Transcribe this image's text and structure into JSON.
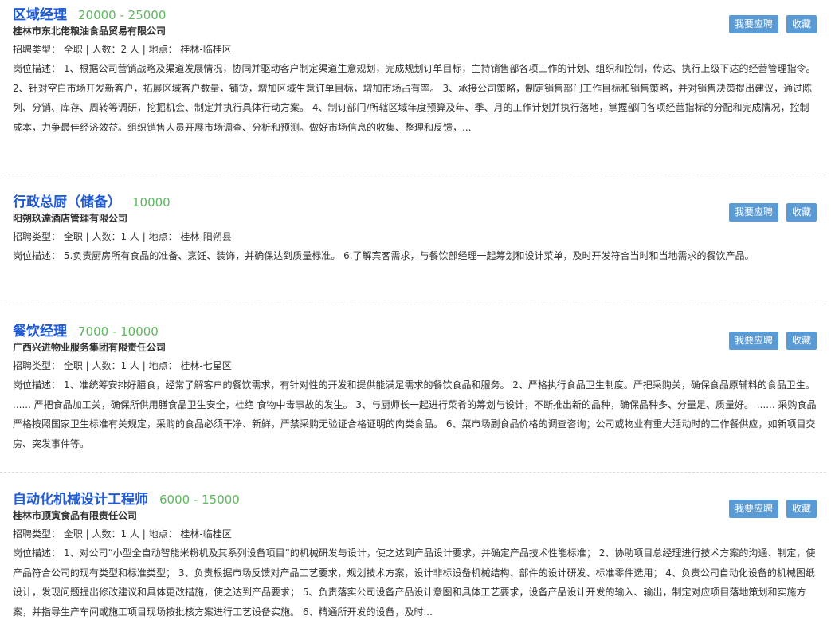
{
  "labels": {
    "type_prefix": "招聘类型：",
    "count_prefix": "人数：",
    "location_prefix": "地点：",
    "desc_prefix": "岗位描述：",
    "apply_button": "我要应聘",
    "favorite_button": "收藏"
  },
  "jobs": [
    {
      "title": "区域经理",
      "salary": "20000 - 25000",
      "company": "桂林市东北佬粮油食品贸易有限公司",
      "meta": "招聘类型： 全职 | 人数：2 人 | 地点： 桂林-临桂区",
      "description": "岗位描述： 1、根据公司营销战略及渠道发展情况，协同并驱动客户制定渠道生意规划，完成规划订单目标，主持销售部各项工作的计划、组织和控制，传达、执行上级下达的经营管理指令。 2、针对空白市场开发新客户，拓展区域客户数量，铺货，增加区域生意订单目标，增加市场占有率。 3、承接公司策略，制定销售部门工作目标和销售策略，并对销售决策提出建议，通过陈列、分销、库存、周转等调研，挖掘机会、制定并执行具体行动方案。 4、制订部门/所辖区域年度预算及年、季、月的工作计划并执行落地，掌握部门各项经营指标的分配和完成情况，控制成本，力争最佳经济效益。组织销售人员开展市场调查、分析和预测。做好市场信息的收集、整理和反馈，..."
    },
    {
      "title": "行政总厨（储备）",
      "salary": "10000",
      "company": "阳朔玖達酒店管理有限公司",
      "meta": "招聘类型： 全职 | 人数：1 人 | 地点： 桂林-阳朔县",
      "description": "岗位描述： 5.负责厨房所有食品的准备、烹饪、装饰，并确保达到质量标准。 6.了解宾客需求，与餐饮部经理一起筹划和设计菜单，及时开发符合当时和当地需求的餐饮产品。"
    },
    {
      "title": "餐饮经理",
      "salary": "7000 - 10000",
      "company": "广西兴进物业服务集团有限责任公司",
      "meta": "招聘类型： 全职 | 人数：1 人 | 地点： 桂林-七星区",
      "description": "岗位描述： 1、准统筹安排好膳食，经常了解客户的餐饮需求，有针对性的开发和提供能满足需求的餐饮食品和服务。 2、严格执行食品卫生制度。严把采购关，确保食品原辅料的食品卫生。 ...... 严把食品加工关，确保所供用膳食品卫生安全，杜绝 食物中毒事故的发生。 3、与厨师长一起进行菜肴的筹划与设计，不断推出新的品种，确保品种多、分量足、质量好。 ...... 采购食品严格按照国家卫生标准有关规定，采购的食品必须干净、新鲜，严禁采购无验证合格证明的肉类食品。 6、菜市场副食品价格的调查咨询；公司或物业有重大活动时的工作餐供应，如新项目交房、突发事件等。"
    },
    {
      "title": "自动化机械设计工程师",
      "salary": "6000 - 15000",
      "company": "桂林市顶寅食品有限责任公司",
      "meta": "招聘类型： 全职 | 人数：1 人 | 地点： 桂林-临桂区",
      "description": "岗位描述： 1、对公司“小型全自动智能米粉机及其系列设备项目”的机械研发与设计，使之达到产品设计要求，并确定产品技术性能标准； 2、协助项目总经理进行技术方案的沟通、制定，使产品符合公司的现有类型和标准类型； 3、负责根据市场反馈对产品工艺要求，规划技术方案，设计非标设备机械结构、部件的设计研发、标准零件选用； 4、负责公司自动化设备的机械图纸设计，发现问题提出修改建议和具体更改措施，使之达到产品要求； 5、负责落实公司设备产品设计意图和具体工艺要求，设备产品设计开发的输入、输出，制定对应项目落地策划和实施方案，并指导生产车间或施工项目现场按批核方案进行工艺设备实施。 6、精通所开发的设备，及时..."
    }
  ]
}
